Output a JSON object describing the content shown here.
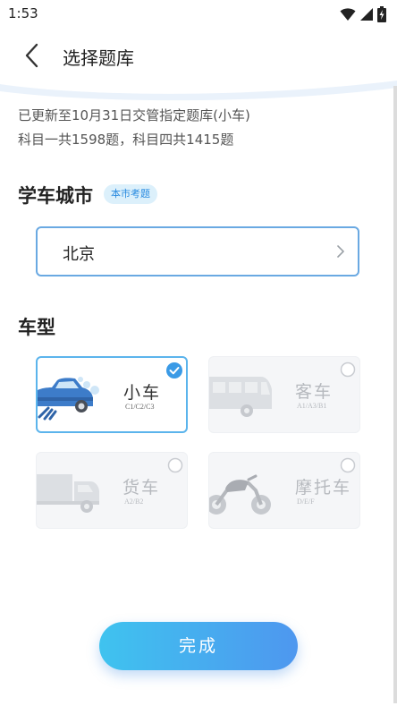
{
  "status_bar": {
    "time": "1:53",
    "icons": [
      "wifi-icon",
      "signal-icon",
      "battery-icon"
    ]
  },
  "header": {
    "title": "选择题库",
    "back_icon": "back-arrow-icon"
  },
  "info": {
    "line1": "已更新至10月31日交管指定题库(小车)",
    "line2": "科目一共1598题，科目四共1415题"
  },
  "city_section": {
    "title": "学车城市",
    "badge": "本市考题",
    "city": "北京"
  },
  "vehicle_section": {
    "title": "车型",
    "items": [
      {
        "name": "小车",
        "sub": "C1/C2/C3",
        "selected": true
      },
      {
        "name": "客车",
        "sub": "A1/A3/B1",
        "selected": false
      },
      {
        "name": "货车",
        "sub": "A2/B2",
        "selected": false
      },
      {
        "name": "摩托车",
        "sub": "D/E/F",
        "selected": false
      }
    ]
  },
  "done_button": {
    "label": "完成"
  },
  "colors": {
    "accent": "#5bb4ec",
    "button_start": "#3fc3ef",
    "button_end": "#4e97ef",
    "badge_text": "#2a8be0"
  }
}
